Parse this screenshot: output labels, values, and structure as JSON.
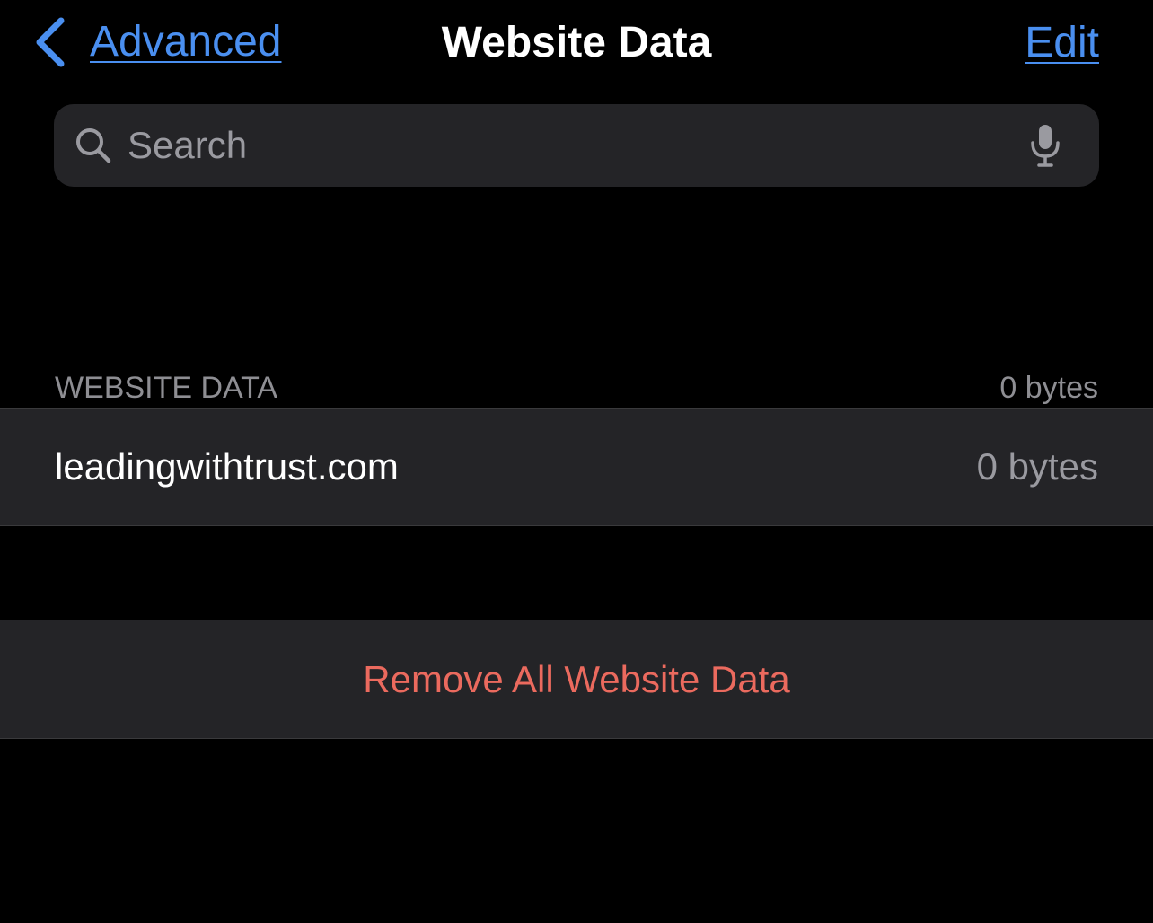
{
  "navbar": {
    "back_label": "Advanced",
    "title": "Website Data",
    "edit_label": "Edit"
  },
  "search": {
    "placeholder": "Search",
    "value": ""
  },
  "section": {
    "header": "WEBSITE DATA",
    "total": "0 bytes"
  },
  "sites": [
    {
      "name": "leadingwithtrust.com",
      "size": "0 bytes"
    }
  ],
  "actions": {
    "remove_all_label": "Remove All Website Data"
  },
  "colors": {
    "accent": "#4a8ff0",
    "destructive": "#eb6a5e",
    "cell_background": "#242427",
    "background": "#000000",
    "secondary_text": "#9a9aa0"
  },
  "icons": {
    "back": "chevron-left-icon",
    "search": "magnifying-glass-icon",
    "mic": "microphone-icon"
  }
}
